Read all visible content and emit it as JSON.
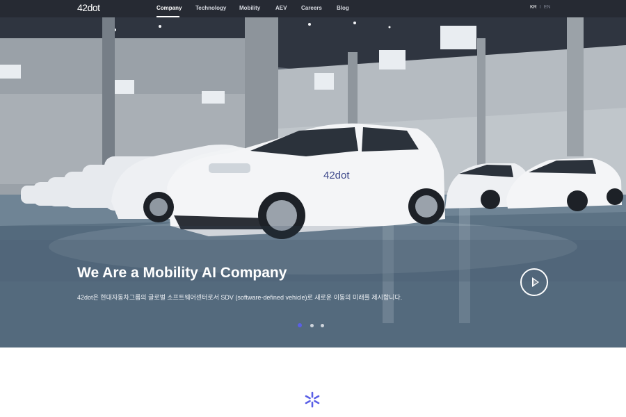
{
  "header": {
    "logo": "42dot",
    "nav": [
      {
        "label": "Company",
        "active": true
      },
      {
        "label": "Technology",
        "active": false
      },
      {
        "label": "Mobility",
        "active": false
      },
      {
        "label": "AEV",
        "active": false
      },
      {
        "label": "Careers",
        "active": false
      },
      {
        "label": "Blog",
        "active": false
      }
    ],
    "lang": {
      "kr": "KR",
      "separator": "I",
      "en": "EN",
      "active": "KR"
    }
  },
  "hero": {
    "title": "We Are a Mobility AI Company",
    "description": "42dot은 현대자동차그룹의 글로벌 소프트웨어센터로서 SDV (software-defined vehicle)로 새로운 이동의 미래를 제시합니다.",
    "car_logo": "42dot",
    "play_icon": "play-icon",
    "slides": {
      "count": 3,
      "active_index": 0
    }
  },
  "colors": {
    "nav_bg": "#262a33",
    "accent": "#5a5fe6",
    "white": "#ffffff"
  },
  "section2": {
    "icon": "42dot-spark-icon"
  }
}
